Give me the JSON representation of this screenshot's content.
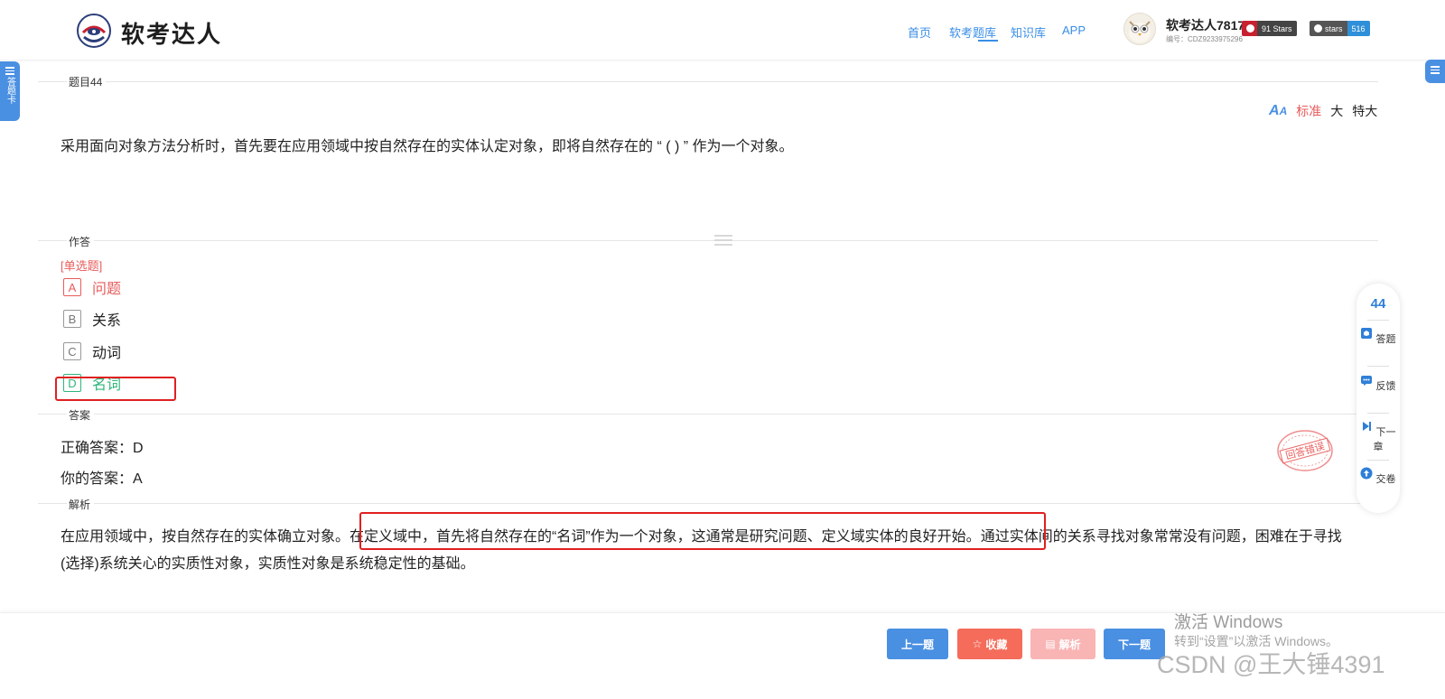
{
  "header": {
    "logo_text": "软考达人",
    "nav": [
      {
        "label": "首页"
      },
      {
        "label": "软考题库",
        "active": true
      },
      {
        "label": "知识库"
      },
      {
        "label": "APP"
      }
    ],
    "user": {
      "name": "软考达人7817",
      "id": "编号：CDZ9233975296"
    },
    "badges": [
      {
        "key": "91 Stars",
        "color": "#c8202f"
      },
      {
        "key": "stars",
        "value": "516",
        "color": "#2f8fd8"
      }
    ]
  },
  "left_tab": {
    "label": "答题卡"
  },
  "sections": {
    "question_title": "题目44",
    "answer_area": "作答",
    "answer": "答案",
    "analysis": "解析"
  },
  "font_size": {
    "options": [
      "标准",
      "大",
      "特大"
    ],
    "active": "标准"
  },
  "question": {
    "text": "采用面向对象方法分析时，首先要在应用领域中按自然存在的实体认定对象，即将自然存在的 “ ( ) ” 作为一个对象。",
    "type": "[单选题]",
    "options": [
      {
        "letter": "A",
        "text": "问题",
        "state": "wrong"
      },
      {
        "letter": "B",
        "text": "关系",
        "state": "normal"
      },
      {
        "letter": "C",
        "text": "动词",
        "state": "normal"
      },
      {
        "letter": "D",
        "text": "名词",
        "state": "correct"
      }
    ]
  },
  "answer": {
    "correct": "正确答案：D",
    "yours": "你的答案：A"
  },
  "analysis": {
    "part1": "在应用领域中，按自然存在的实体确立对象。",
    "part2": "在定义域中，首先将自然存在的“名词”作为一个对象，这通常是研究问题、定义域实体的良好开始。",
    "part3": "通过实体间的关系寻找对象常常没有问题，困难在于寻找(选择)系统关心的实质性对象，实质性对象是系统稳定性的基础。"
  },
  "side_bar": {
    "number": "44",
    "items": [
      {
        "label": "答题",
        "icon": "answer-sheet-icon"
      },
      {
        "label": "反馈",
        "icon": "feedback-icon"
      },
      {
        "label": "下一章",
        "icon": "next-chapter-icon"
      },
      {
        "label": "交卷",
        "icon": "submit-icon"
      }
    ]
  },
  "stamp": {
    "text": "回答错误"
  },
  "buttons": {
    "prev": "上一题",
    "favorite": "收藏",
    "analysis": "解析",
    "next": "下一题"
  },
  "watermark": {
    "activate_title": "激活 Windows",
    "activate_sub": "转到“设置”以激活 Windows。",
    "csdn": "CSDN @王大锤4391"
  },
  "colors": {
    "primary": "#4a90e2",
    "wrong": "#e85c5c",
    "correct": "#2fb57b",
    "favorite": "#f56c5b",
    "analysis_btn_disabled": "#f9b4b4"
  }
}
